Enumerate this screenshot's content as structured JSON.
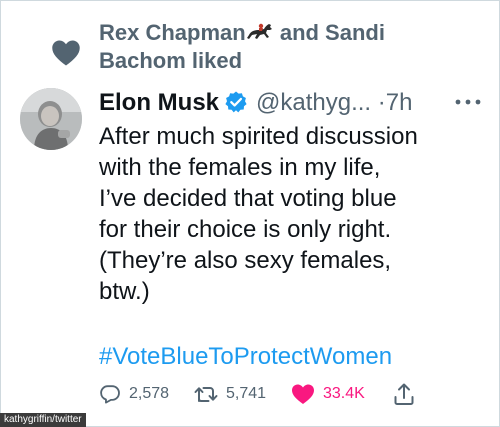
{
  "social_context": {
    "text_before_icon": "Rex Chapman",
    "icon": "horse-racing-icon",
    "text_after_icon": " and Sandi Bachom liked"
  },
  "tweet": {
    "display_name": "Elon Musk",
    "handle": "@kathyg...",
    "separator": "·",
    "time": "7h",
    "verified": true,
    "text_lines": [
      "After much spirited discussion",
      "with the females in my life,",
      "I’ve decided that voting blue",
      "for their choice is only right.",
      "(They’re also sexy females,",
      "btw.)"
    ],
    "hashtag": "#VoteBlueToProtectWomen"
  },
  "actions": {
    "replies": "2,578",
    "retweets": "5,741",
    "likes": "33.4K"
  },
  "credit": "kathygriffin/twitter",
  "colors": {
    "text": "#0f1419",
    "secondary": "#536471",
    "link": "#1d9bf0",
    "like": "#f91880",
    "verified": "#1d9bf0"
  }
}
